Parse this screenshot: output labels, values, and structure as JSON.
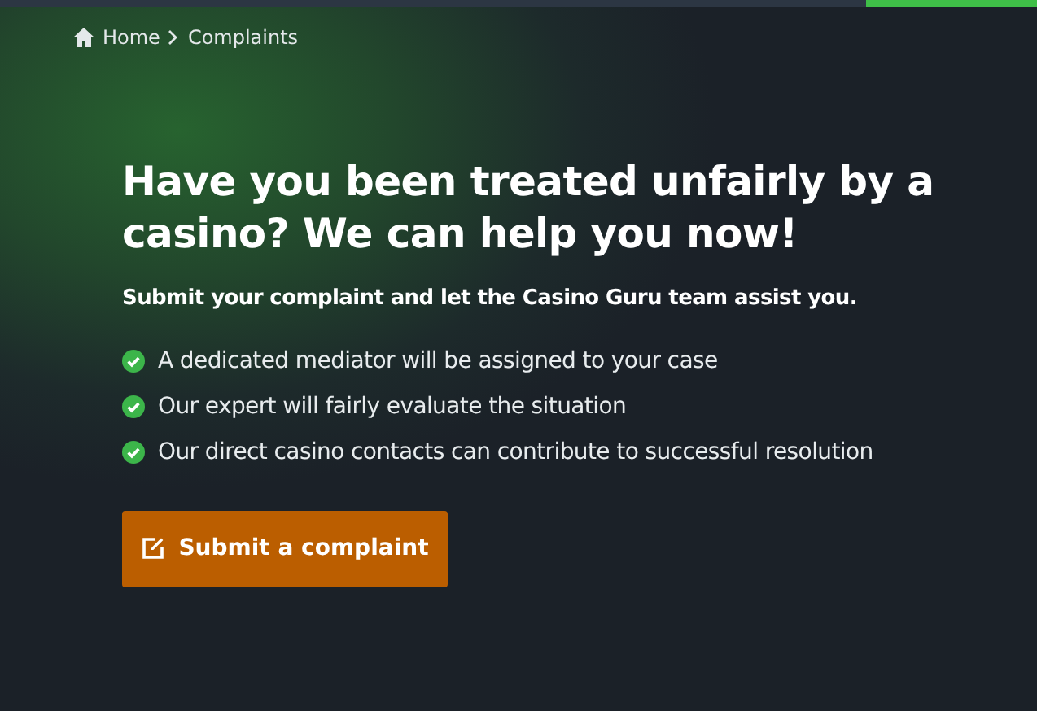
{
  "breadcrumb": [
    {
      "label": "Home",
      "kind": "home"
    },
    {
      "label": "Complaints",
      "kind": "page"
    }
  ],
  "heading": "Have you been treated unfairly by a casino? We can help you now!",
  "subtitle": "Submit your complaint and let the Casino Guru team assist you.",
  "benefits": [
    "A dedicated mediator will be assigned to your case",
    "Our expert will fairly evaluate the situation",
    "Our direct casino contacts can contribute to successful resolution"
  ],
  "button": {
    "label": "Submit a complaint"
  }
}
